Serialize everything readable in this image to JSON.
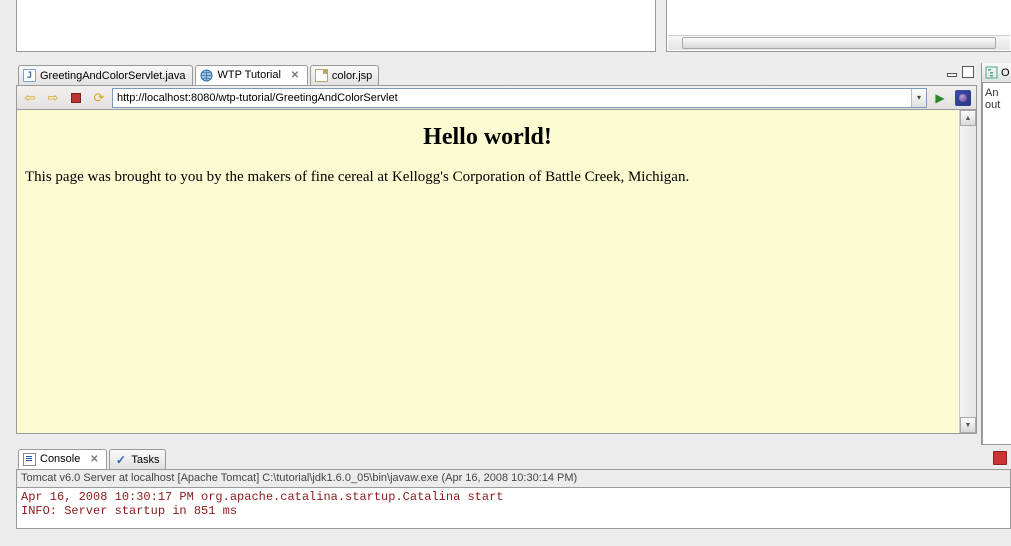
{
  "tabs": [
    {
      "label": "GreetingAndColorServlet.java",
      "active": false,
      "closable": false
    },
    {
      "label": "WTP Tutorial",
      "active": true,
      "closable": true
    },
    {
      "label": "color.jsp",
      "active": false,
      "closable": false
    }
  ],
  "browser": {
    "url": "http://localhost:8080/wtp-tutorial/GreetingAndColorServlet",
    "heading": "Hello world!",
    "paragraph": "This page was brought to you by the makers of fine cereal at Kellogg's Corporation of Battle Creek, Michigan."
  },
  "outline": {
    "tab_label": "O",
    "body": "An out"
  },
  "bottom_tabs": [
    {
      "label": "Console",
      "active": true,
      "closable": true
    },
    {
      "label": "Tasks",
      "active": false,
      "closable": false
    }
  ],
  "console": {
    "title": "Tomcat v6.0 Server at localhost [Apache Tomcat] C:\\tutorial\\jdk1.6.0_05\\bin\\javaw.exe (Apr 16, 2008 10:30:14 PM)",
    "lines": [
      "Apr 16, 2008 10:30:17 PM org.apache.catalina.startup.Catalina start",
      "INFO: Server startup in 851 ms"
    ]
  }
}
